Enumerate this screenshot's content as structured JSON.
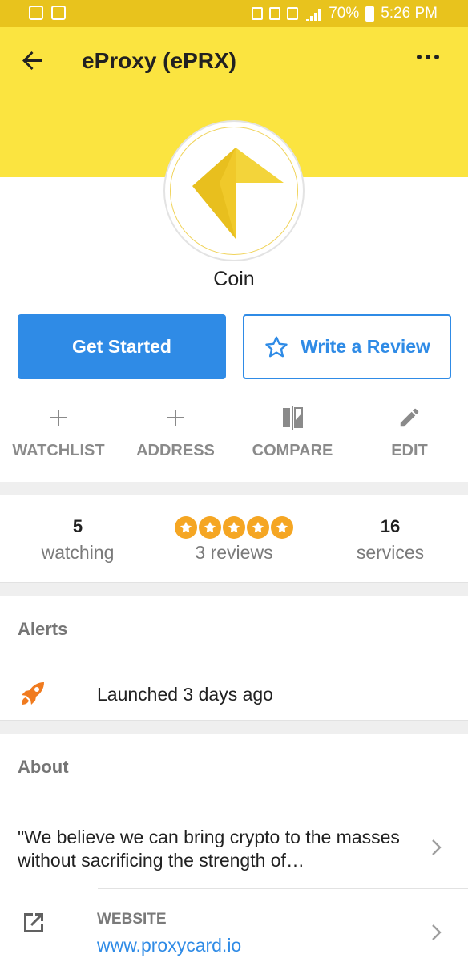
{
  "status_bar": {
    "battery": "70%",
    "time": "5:26 PM"
  },
  "header": {
    "title": "eProxy (ePRX)",
    "back_icon": "arrow-left-icon",
    "more_icon": "more-dots-icon",
    "background_color": "#fbe440"
  },
  "profile": {
    "coin_type": "Coin",
    "primary_button": "Get Started",
    "secondary_button": "Write a Review",
    "actions": [
      {
        "icon": "plus-icon",
        "label": "WATCHLIST"
      },
      {
        "icon": "plus-icon",
        "label": "ADDRESS"
      },
      {
        "icon": "compare-icon",
        "label": "COMPARE"
      },
      {
        "icon": "pencil-icon",
        "label": "EDIT"
      }
    ]
  },
  "stats": {
    "watching_count": "5",
    "watching_label": "watching",
    "rating_stars": 5,
    "reviews_label": "3 reviews",
    "services_count": "16",
    "services_label": "services"
  },
  "alerts": {
    "title": "Alerts",
    "items": [
      {
        "icon": "rocket-icon",
        "text": "Launched 3 days ago"
      }
    ]
  },
  "about": {
    "title": "About",
    "description": "\"We believe we can bring crypto to the masses without sacrificing the strength of…",
    "website_label": "WEBSITE",
    "website_url": "www.proxycard.io"
  },
  "colors": {
    "accent_blue": "#2f8be6",
    "star_orange": "#f5a623",
    "rocket_orange": "#f07b1f"
  }
}
